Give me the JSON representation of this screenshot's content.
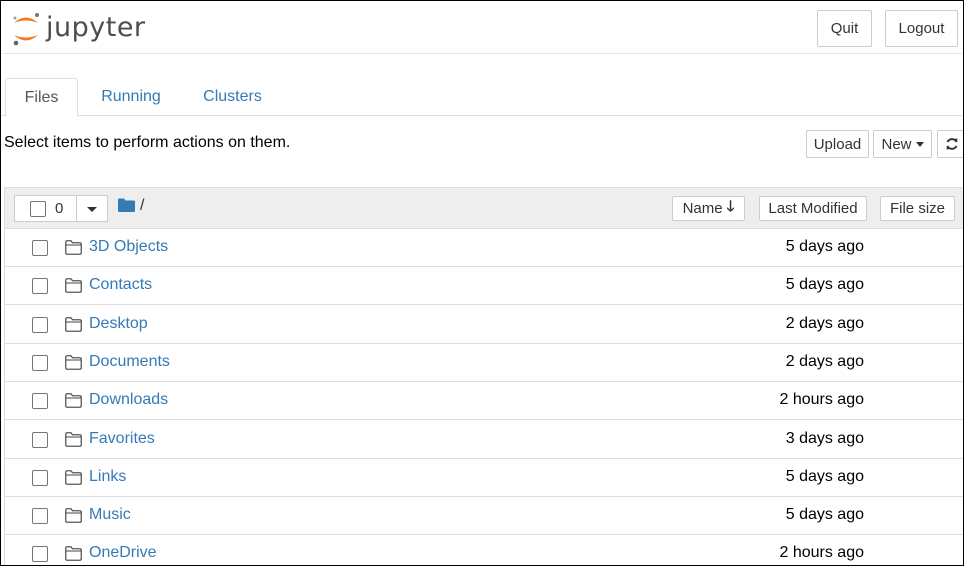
{
  "header": {
    "logo_text": "jupyter",
    "quit_label": "Quit",
    "logout_label": "Logout"
  },
  "tabs": [
    {
      "label": "Files",
      "active": true
    },
    {
      "label": "Running",
      "active": false
    },
    {
      "label": "Clusters",
      "active": false
    }
  ],
  "toolbar": {
    "hint": "Select items to perform actions on them.",
    "upload_label": "Upload",
    "new_label": "New"
  },
  "list_header": {
    "selected_count": "0",
    "breadcrumb_path": "/",
    "sort_name_label": "Name",
    "sort_modified_label": "Last Modified",
    "sort_size_label": "File size"
  },
  "items": [
    {
      "name": "3D Objects",
      "modified": "5 days ago"
    },
    {
      "name": "Contacts",
      "modified": "5 days ago"
    },
    {
      "name": "Desktop",
      "modified": "2 days ago"
    },
    {
      "name": "Documents",
      "modified": "2 days ago"
    },
    {
      "name": "Downloads",
      "modified": "2 hours ago"
    },
    {
      "name": "Favorites",
      "modified": "3 days ago"
    },
    {
      "name": "Links",
      "modified": "5 days ago"
    },
    {
      "name": "Music",
      "modified": "5 days ago"
    },
    {
      "name": "OneDrive",
      "modified": "2 hours ago"
    }
  ],
  "colors": {
    "link": "#337ab7",
    "logo_orange": "#f37726",
    "logo_gray": "#4e4e4e",
    "header_bg": "#eeeeee"
  }
}
